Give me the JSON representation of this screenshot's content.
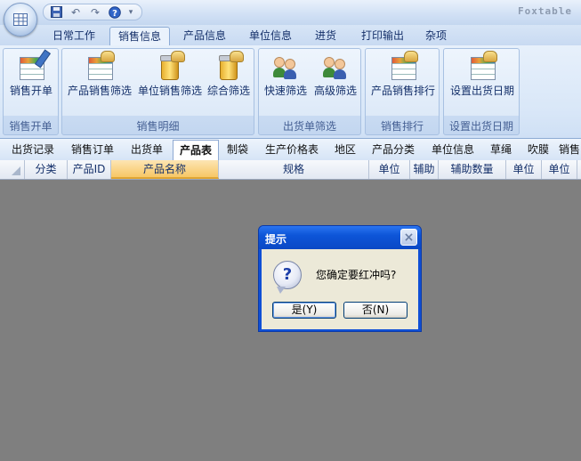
{
  "app": {
    "title": "Foxtable"
  },
  "quick_access": {
    "icons": [
      "save-icon",
      "undo-icon",
      "redo-icon",
      "help-icon",
      "customize-icon"
    ]
  },
  "ribbon_tabs": [
    {
      "label": "日常工作"
    },
    {
      "label": "销售信息",
      "active": true
    },
    {
      "label": "产品信息"
    },
    {
      "label": "单位信息"
    },
    {
      "label": "进货"
    },
    {
      "label": "打印输出"
    },
    {
      "label": "杂项"
    }
  ],
  "ribbon_groups": [
    {
      "label": "销售开单",
      "buttons": [
        {
          "label": "销售开单",
          "icon": "table-edit-icon"
        }
      ]
    },
    {
      "label": "销售明细",
      "buttons": [
        {
          "label": "产品销售筛选",
          "icon": "table-filter-icon"
        },
        {
          "label": "单位销售筛选",
          "icon": "jar-filter-icon"
        },
        {
          "label": "综合筛选",
          "icon": "jar-filter-icon"
        }
      ]
    },
    {
      "label": "出货单筛选",
      "buttons": [
        {
          "label": "快速筛选",
          "icon": "users-icon"
        },
        {
          "label": "高级筛选",
          "icon": "users-icon"
        }
      ]
    },
    {
      "label": "销售排行",
      "buttons": [
        {
          "label": "产品销售排行",
          "icon": "table-filter-icon"
        }
      ]
    },
    {
      "label": "设置出货日期",
      "buttons": [
        {
          "label": "设置出货日期",
          "icon": "table-filter-icon"
        }
      ]
    }
  ],
  "sub_tabs": [
    {
      "label": "出货记录"
    },
    {
      "label": "销售订单"
    },
    {
      "label": "出货单"
    },
    {
      "label": "产品表",
      "active": true
    },
    {
      "label": "制袋"
    },
    {
      "label": "生产价格表"
    },
    {
      "label": "地区"
    },
    {
      "label": "产品分类"
    },
    {
      "label": "单位信息"
    },
    {
      "label": "草绳"
    },
    {
      "label": "吹膜"
    },
    {
      "label": "销售"
    }
  ],
  "grid": {
    "columns": [
      {
        "label": "分类"
      },
      {
        "label": "产品ID"
      },
      {
        "label": "产品名称",
        "selected": true
      },
      {
        "label": "规格"
      },
      {
        "label": "单位"
      },
      {
        "label": "辅助"
      },
      {
        "label": "辅助数量"
      },
      {
        "label": "单位"
      },
      {
        "label": "单位"
      }
    ]
  },
  "dialog": {
    "title": "提示",
    "message": "您确定要红冲吗?",
    "icon": "question-icon",
    "yes_label": "是(Y)",
    "no_label": "否(N)"
  },
  "colors": {
    "ribbon_bg": "#dce8f8",
    "dialog_title": "#0d55d8",
    "selected_column": "#f7c766",
    "workspace": "#7f7f7f"
  }
}
